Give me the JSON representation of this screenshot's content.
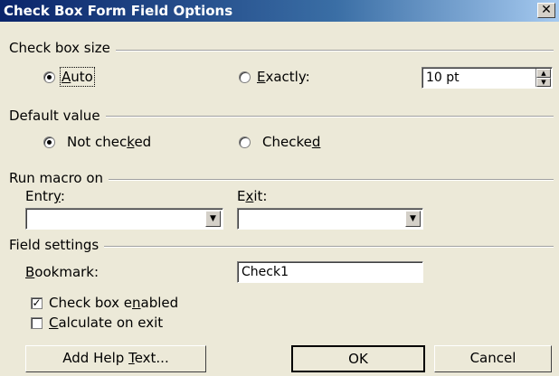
{
  "dialog": {
    "title": "Check Box Form Field Options",
    "close_glyph": "✕"
  },
  "check_box_size": {
    "heading": "Check box size",
    "auto_label": "Auto",
    "exactly_label": "Exactly:",
    "selected": "auto",
    "size_value": "10 pt"
  },
  "default_value": {
    "heading": "Default value",
    "not_checked_label": "Not checked",
    "checked_label": "Checked",
    "selected": "not_checked"
  },
  "run_macro": {
    "heading": "Run macro on",
    "entry_label": "Entry:",
    "exit_label": "Exit:",
    "entry_value": "",
    "exit_value": ""
  },
  "field_settings": {
    "heading": "Field settings",
    "bookmark_label": "Bookmark:",
    "bookmark_value": "Check1",
    "enabled_label": "Check box enabled",
    "enabled_checked": true,
    "calculate_label": "Calculate on exit",
    "calculate_checked": false
  },
  "buttons": {
    "help_label": "Add Help Text...",
    "ok_label": "OK",
    "cancel_label": "Cancel"
  }
}
